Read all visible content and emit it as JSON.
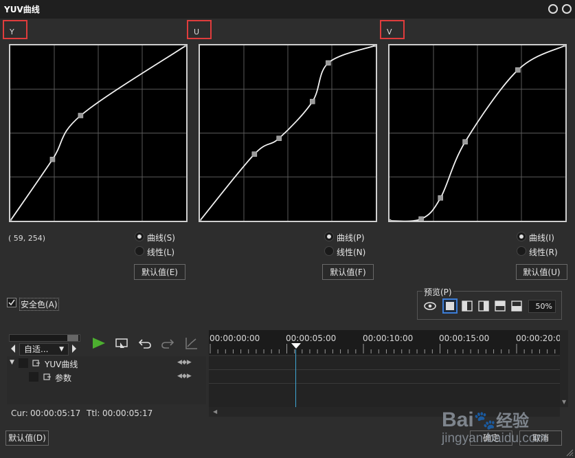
{
  "window": {
    "title": "YUV曲线"
  },
  "curves": [
    {
      "channel_label": "Y",
      "radio_curve": "曲线(S)",
      "radio_linear": "线性(L)",
      "default_btn": "默认值(E)",
      "points": [
        [
          0,
          0
        ],
        [
          0.24,
          0.35
        ],
        [
          0.4,
          0.6
        ],
        [
          1,
          1
        ]
      ],
      "selected_mode": "curve"
    },
    {
      "channel_label": "U",
      "radio_curve": "曲线(P)",
      "radio_linear": "线性(N)",
      "default_btn": "默认值(F)",
      "points": [
        [
          0,
          0
        ],
        [
          0.31,
          0.38
        ],
        [
          0.45,
          0.47
        ],
        [
          0.64,
          0.68
        ],
        [
          0.73,
          0.9
        ],
        [
          1,
          1
        ]
      ],
      "selected_mode": "curve"
    },
    {
      "channel_label": "V",
      "radio_curve": "曲线(I)",
      "radio_linear": "线性(R)",
      "default_btn": "默认值(U)",
      "points": [
        [
          0,
          0
        ],
        [
          0.18,
          0.01
        ],
        [
          0.29,
          0.13
        ],
        [
          0.43,
          0.45
        ],
        [
          0.73,
          0.86
        ],
        [
          1,
          1
        ]
      ],
      "selected_mode": "curve"
    }
  ],
  "coord_readout": "( 59, 254)",
  "safe_color": {
    "label": "安全色(A)",
    "checked": true
  },
  "preview": {
    "label": "预览(P)",
    "percent": "50%"
  },
  "timeline": {
    "mode": "自适...",
    "timecodes": [
      "00:00:00:00",
      "00:00:05:00",
      "00:00:10:00",
      "00:00:15:00",
      "00:00:20:0"
    ],
    "tracks": [
      {
        "name": "YUV曲线"
      },
      {
        "name": "参数"
      }
    ],
    "cur_label": "Cur:",
    "cur_value": "00:00:05:17",
    "ttl_label": "Ttl:",
    "ttl_value": "00:00:05:17"
  },
  "footer": {
    "default_btn": "默认值(D)",
    "ok_btn": "确定",
    "cancel_btn": "取消"
  },
  "watermark": {
    "logo": "Bai",
    "logo2": "经验",
    "url": "jingyan.baidu.com"
  }
}
